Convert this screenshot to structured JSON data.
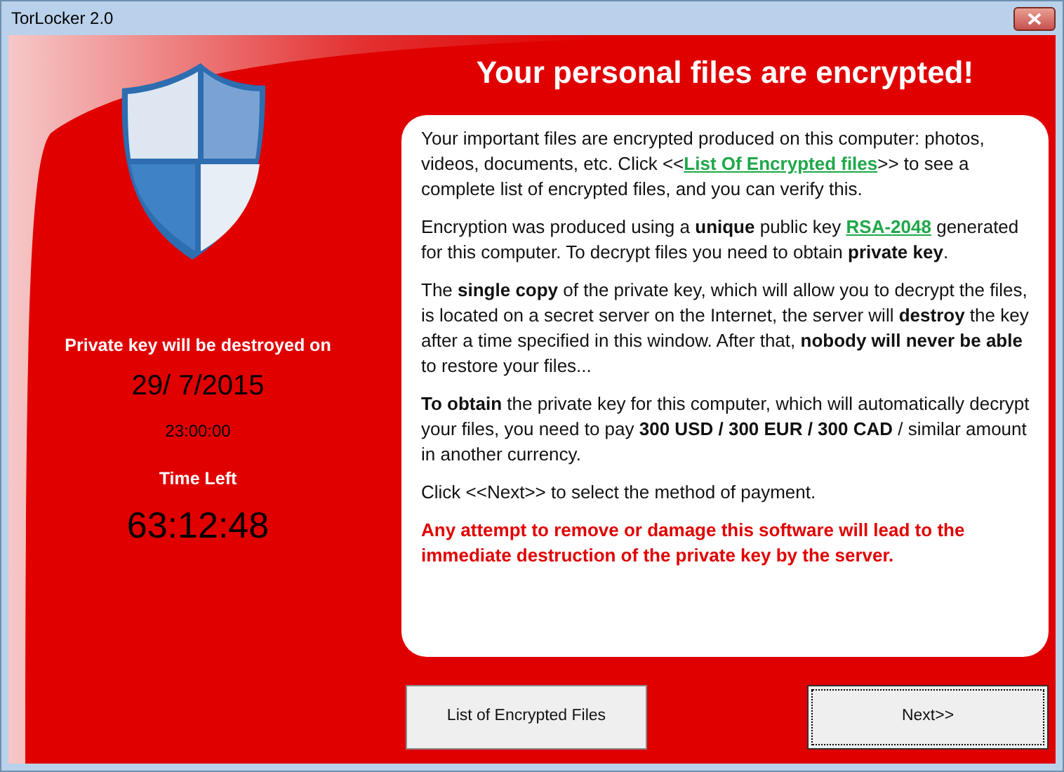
{
  "window": {
    "title": "TorLocker 2.0"
  },
  "heading": "Your personal files are encrypted!",
  "left_panel": {
    "destroy_label": "Private key will be destroyed on",
    "date": "29/ 7/2015",
    "time": "23:00:00",
    "time_left_label": "Time Left",
    "countdown": "63:12:48"
  },
  "message": [
    {
      "kind": "link",
      "before": "Your important files are encrypted produced on this computer: photos, videos, documents, etc. Click <<",
      "link": "List Of Encrypted files",
      "after": ">> to see a complete list of encrypted files, and you can verify this."
    },
    {
      "kind": "link",
      "before": "Encryption was produced using a **unique** public key ",
      "link": "RSA-2048",
      "after": " generated for this computer. To decrypt files you need to obtain **private key**."
    },
    {
      "kind": "text",
      "text": "The **single copy** of the private key, which will allow you to decrypt the files, is located on a secret server on the Internet, the server will **destroy** the key after a time specified in this window. After that, **nobody will never be able** to restore your files..."
    },
    {
      "kind": "text",
      "text": "**To obtain** the private key for this computer, which will automatically decrypt your files, you need to pay **300 USD / 300 EUR / 300 CAD** / similar amount in another currency."
    },
    {
      "kind": "text",
      "text": "Click <<Next>> to select the method of payment."
    },
    {
      "kind": "warning",
      "text": "Any attempt to remove or damage this software will lead to the immediate destruction of the private key by the server."
    }
  ],
  "buttons": [
    {
      "label": "List of Encrypted Files",
      "focused": false
    },
    {
      "label": "Next>>",
      "focused": true
    }
  ]
}
